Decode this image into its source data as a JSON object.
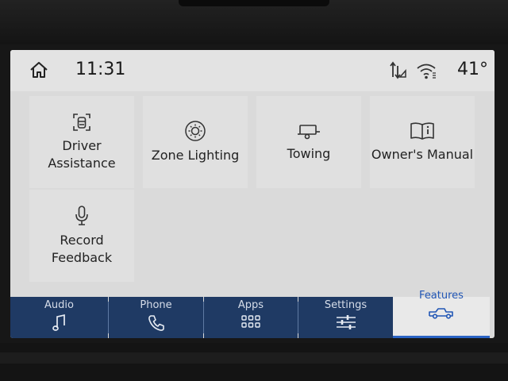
{
  "status": {
    "time": "11:31",
    "temperature": "41°",
    "icons": [
      "home-icon",
      "data-transfer-icon",
      "wifi-icon"
    ]
  },
  "tiles": [
    {
      "label": "Driver Assistance",
      "icon": "driver-assist-icon"
    },
    {
      "label": "Zone Lighting",
      "icon": "zone-lighting-icon"
    },
    {
      "label": "Towing",
      "icon": "trailer-icon"
    },
    {
      "label": "Owner's Manual",
      "icon": "book-icon"
    },
    {
      "label": "Record Feedback",
      "icon": "microphone-icon"
    }
  ],
  "nav": [
    {
      "label": "Audio",
      "icon": "music-note-icon"
    },
    {
      "label": "Phone",
      "icon": "phone-icon"
    },
    {
      "label": "Apps",
      "icon": "apps-grid-icon"
    },
    {
      "label": "Settings",
      "icon": "sliders-icon"
    },
    {
      "label": "Features",
      "icon": "truck-icon",
      "active": true
    }
  ],
  "colors": {
    "nav_background": "#1f3a64",
    "active_accent": "#2a63c4",
    "screen_background": "#dadada"
  }
}
